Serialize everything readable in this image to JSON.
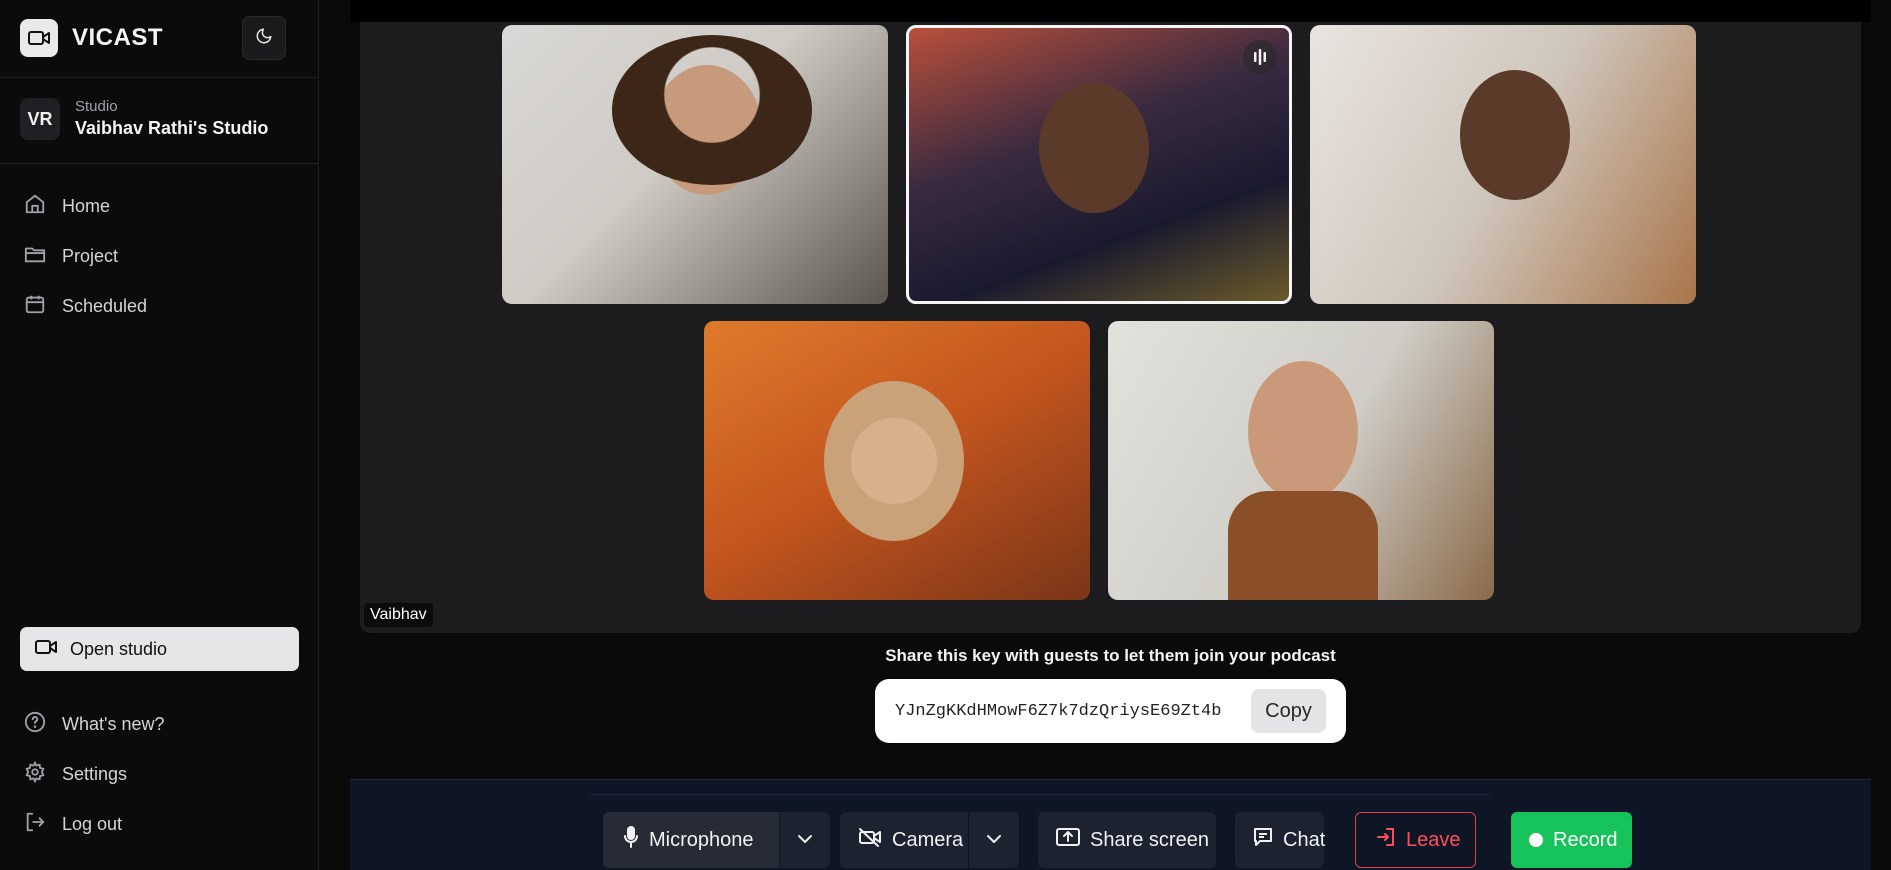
{
  "brand": {
    "name": "VICAST"
  },
  "studio": {
    "avatar_initials": "VR",
    "subtitle": "Studio",
    "name": "Vaibhav Rathi's Studio"
  },
  "nav": {
    "home": "Home",
    "project": "Project",
    "scheduled": "Scheduled"
  },
  "open_studio": "Open studio",
  "footer_nav": {
    "whats_new": "What's new?",
    "settings": "Settings",
    "logout": "Log out"
  },
  "stage": {
    "local_name_tag": "Vaibhav"
  },
  "share": {
    "instruction": "Share this key with guests to let them join your podcast",
    "key": "YJnZgKKdHMowF6Z7k7dzQriysE69Zt4b",
    "copy_label": "Copy"
  },
  "controls": {
    "microphone": "Microphone",
    "camera": "Camera",
    "share_screen": "Share screen",
    "chat": "Chat",
    "leave": "Leave",
    "record": "Record"
  },
  "colors": {
    "accent_record": "#16c35a",
    "leave_red": "#ff4d5a",
    "speaking_border": "#f5f5f5"
  }
}
